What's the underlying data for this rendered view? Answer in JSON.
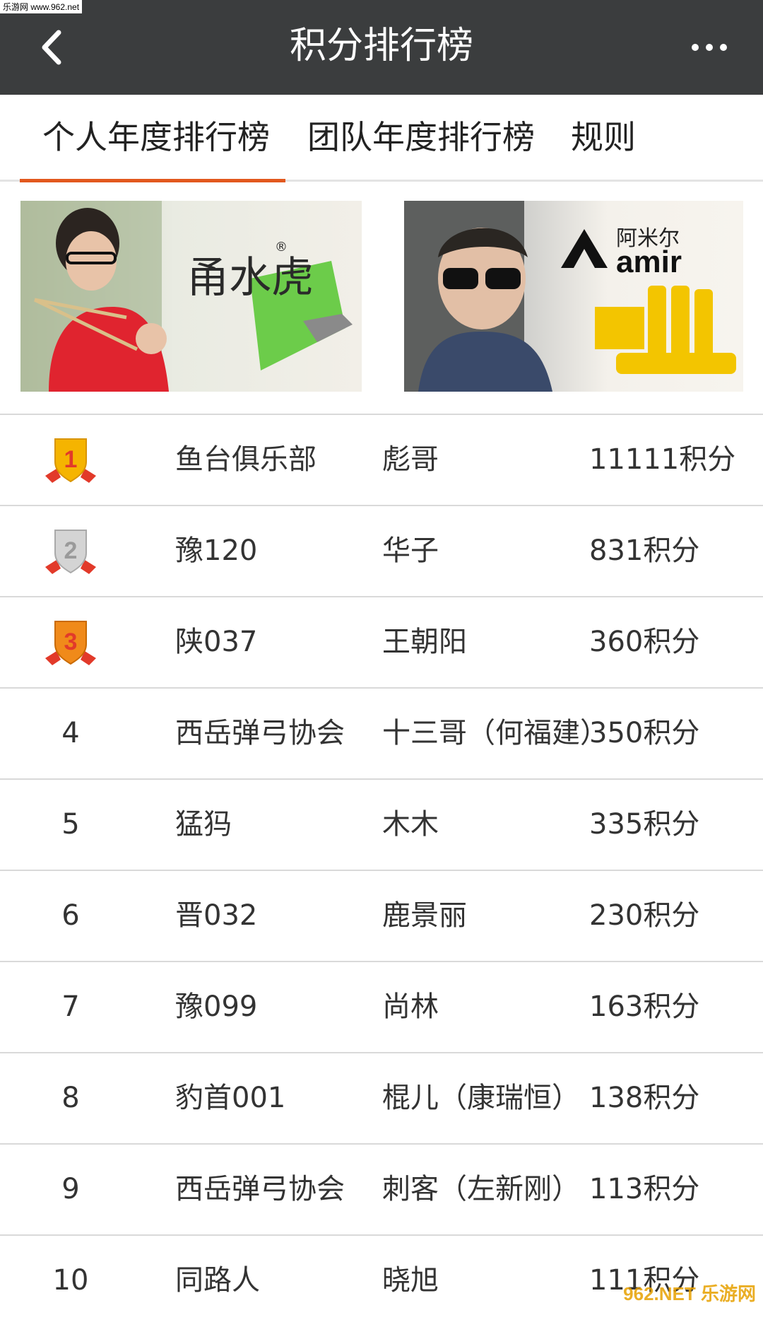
{
  "watermark_top": "乐游网 www.962.net",
  "header": {
    "title": "积分排行榜"
  },
  "tabs": [
    {
      "label": "个人年度排行榜",
      "active": true
    },
    {
      "label": "团队年度排行榜",
      "active": false
    },
    {
      "label": "规则",
      "active": false
    }
  ],
  "banners": [
    {
      "brand_text": "甬水虎",
      "mark": "®"
    },
    {
      "brand_cn": "阿米尔",
      "brand_en": "amir"
    }
  ],
  "rankings": [
    {
      "rank": "1",
      "club": "鱼台俱乐部",
      "name": "彪哥",
      "score": "11111积分",
      "medal": "gold"
    },
    {
      "rank": "2",
      "club": "豫120",
      "name": "华子",
      "score": "831积分",
      "medal": "silver"
    },
    {
      "rank": "3",
      "club": "陕037",
      "name": "王朝阳",
      "score": "360积分",
      "medal": "bronze"
    },
    {
      "rank": "4",
      "club": "西岳弹弓协会",
      "name": "十三哥（何福建）",
      "score": "350积分"
    },
    {
      "rank": "5",
      "club": "猛犸",
      "name": "木木",
      "score": "335积分"
    },
    {
      "rank": "6",
      "club": "晋032",
      "name": "鹿景丽",
      "score": "230积分"
    },
    {
      "rank": "7",
      "club": "豫099",
      "name": "尚林",
      "score": "163积分"
    },
    {
      "rank": "8",
      "club": "豹首001",
      "name": "棍儿（康瑞恒）",
      "score": "138积分"
    },
    {
      "rank": "9",
      "club": "西岳弹弓协会",
      "name": "刺客（左新刚）",
      "score": "113积分"
    },
    {
      "rank": "10",
      "club": "同路人",
      "name": "晓旭",
      "score": "111积分"
    }
  ],
  "watermark_bottom": "962.NET 乐游网",
  "colors": {
    "titlebar": "#3b3d3e",
    "accent": "#e2581e",
    "gold": "#f5b400",
    "silver": "#c4c4c4",
    "bronze": "#f08a1a",
    "ribbon": "#e23a2a"
  }
}
